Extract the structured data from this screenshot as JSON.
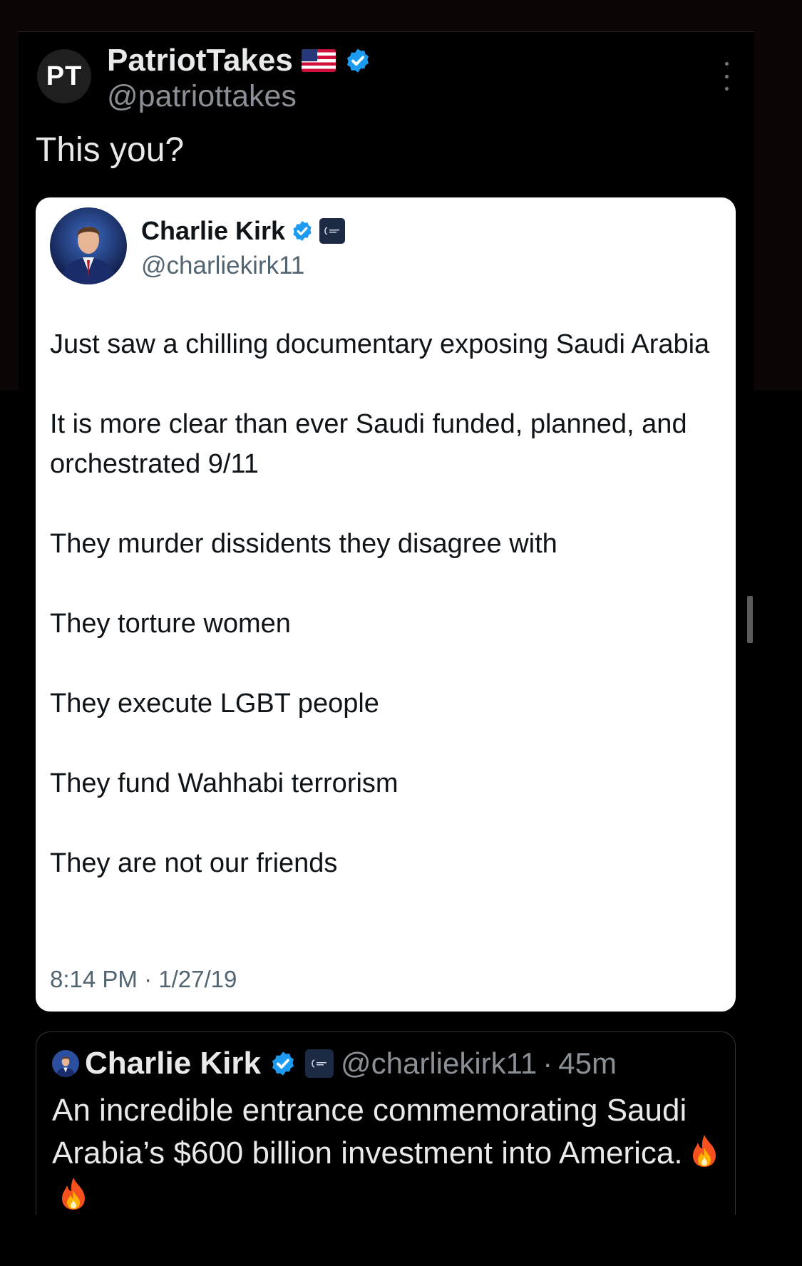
{
  "post": {
    "avatar_initials": "PT",
    "author_name": "PatriotTakes",
    "author_handle": "@patriottakes",
    "text": "This you?"
  },
  "screenshot_card": {
    "author_name": "Charlie Kirk",
    "author_handle": "@charliekirk11",
    "paragraphs": [
      "Just saw a chilling documentary exposing Saudi Arabia",
      "It is more clear than ever Saudi funded, planned, and orchestrated 9/11",
      "They murder dissidents they disagree with",
      "They torture women",
      "They execute LGBT people",
      "They fund Wahhabi terrorism",
      "They are not our friends"
    ],
    "timestamp": "8:14 PM · 1/27/19"
  },
  "quoted_tweet": {
    "author_name": "Charlie Kirk",
    "author_handle": "@charliekirk11",
    "separator": "·",
    "age": "45m",
    "text": "An incredible entrance commemorating Saudi Arabia’s $600 billion investment into America."
  },
  "icons": {
    "flag": "us-flag-icon",
    "verified": "verified-badge-icon",
    "org": "organization-badge-icon",
    "more": "more-options-icon",
    "fire": "fire-emoji-icon"
  },
  "colors": {
    "verified_blue": "#1d9bf0",
    "text_primary": "#e7e9ea",
    "text_secondary": "#8b9096",
    "card_bg": "#ffffff"
  }
}
